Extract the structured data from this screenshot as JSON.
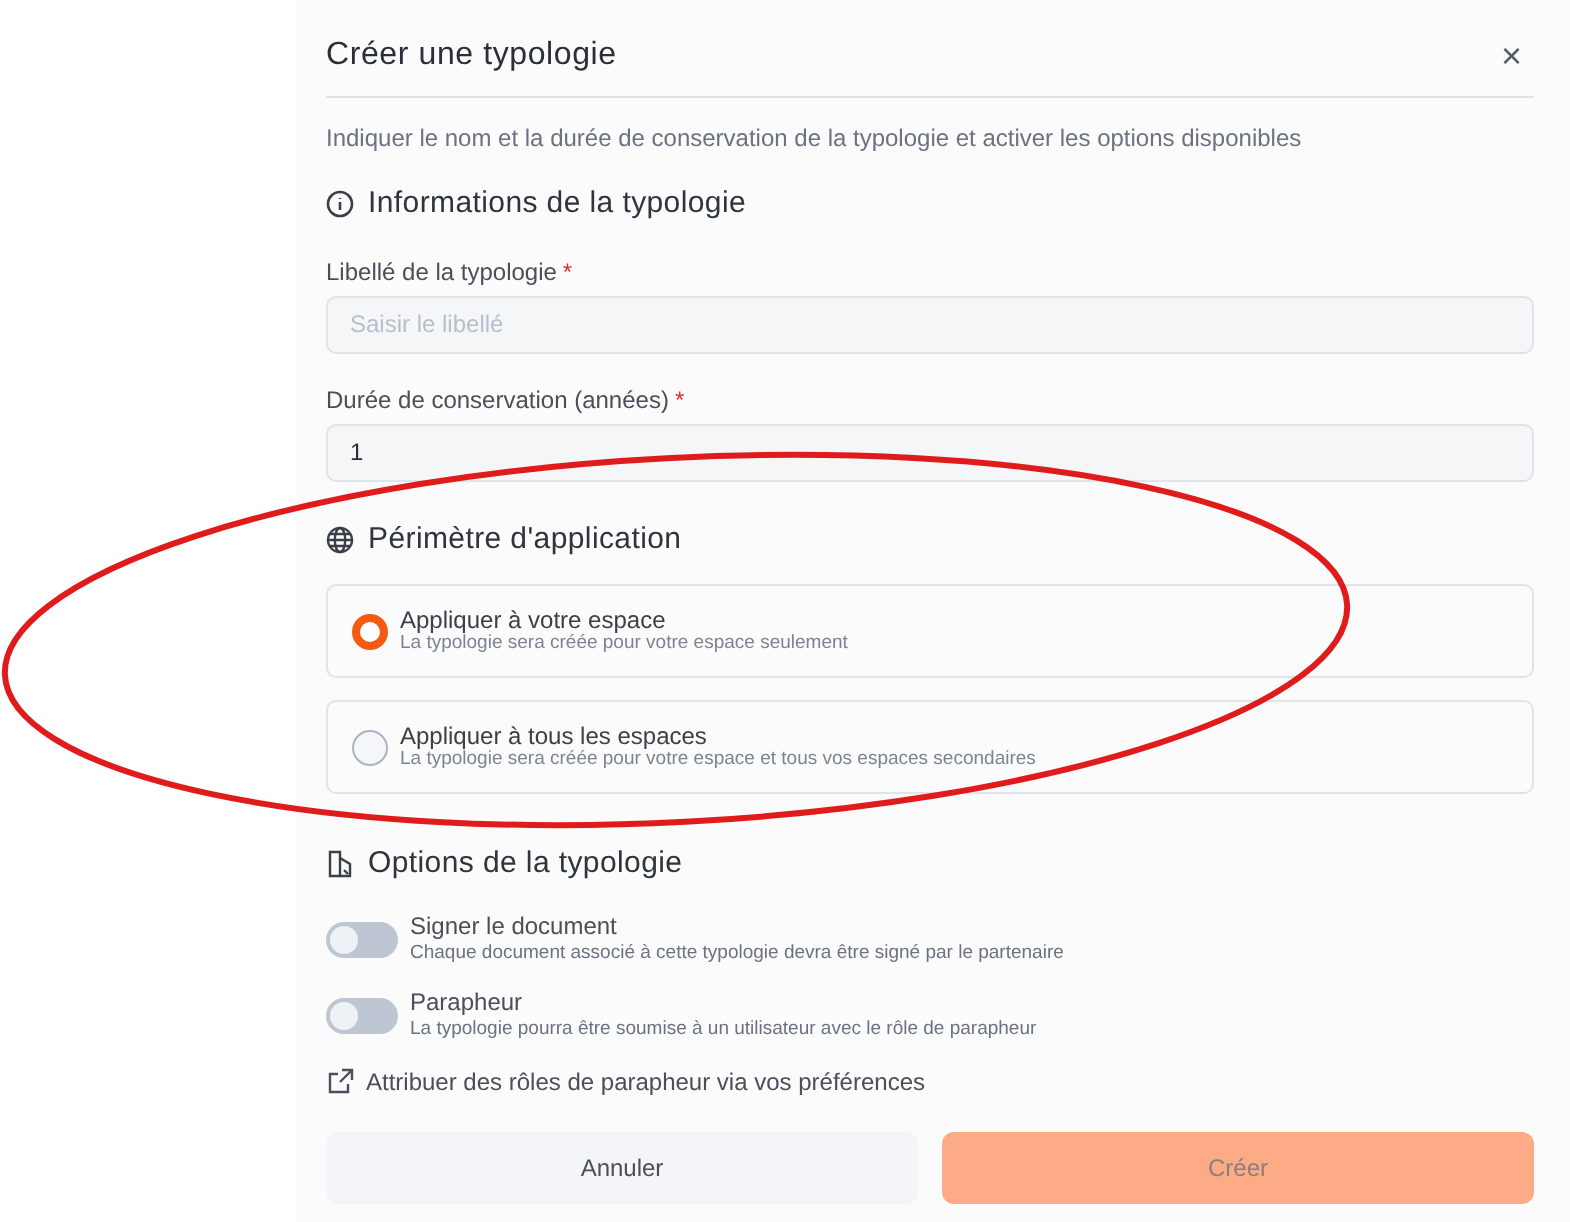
{
  "dialog": {
    "title": "Créer une typologie",
    "close": "×",
    "description": "Indiquer le nom et la durée de conservation de la typologie et activer les options disponibles"
  },
  "sections": [
    {
      "kind": "fields",
      "title": "Informations de la typologie",
      "fields": [
        {
          "label": "Libellé de la typologie",
          "required_mark": "*",
          "placeholder": "Saisir le libellé"
        },
        {
          "label": "Durée de conservation (années)",
          "required_mark": "*",
          "value": "1"
        }
      ]
    },
    {
      "kind": "radios",
      "title": "Périmètre d'application",
      "options": [
        {
          "label": "Appliquer à votre espace",
          "description": "La typologie sera créée pour votre espace seulement",
          "selected": true
        },
        {
          "label": "Appliquer à tous les espaces",
          "description": "La typologie sera créée pour votre espace et tous vos espaces secondaires",
          "selected": false
        }
      ]
    },
    {
      "kind": "toggles",
      "title": "Options de la typologie",
      "toggles": [
        {
          "label": "Signer le document",
          "description": "Chaque document associé à cette typologie devra être signé par le partenaire",
          "on": false
        },
        {
          "label": "Parapheur",
          "description": "La typologie pourra être soumise à un utilisateur avec le rôle de parapheur",
          "on": false
        }
      ],
      "link": "Attribuer des rôles de parapheur via vos préférences"
    }
  ],
  "buttons": [
    {
      "label": "Annuler",
      "kind": "secondary",
      "disabled": false
    },
    {
      "label": "Créer",
      "kind": "primary",
      "disabled": true
    }
  ],
  "annotation": {
    "kind": "ellipse"
  }
}
